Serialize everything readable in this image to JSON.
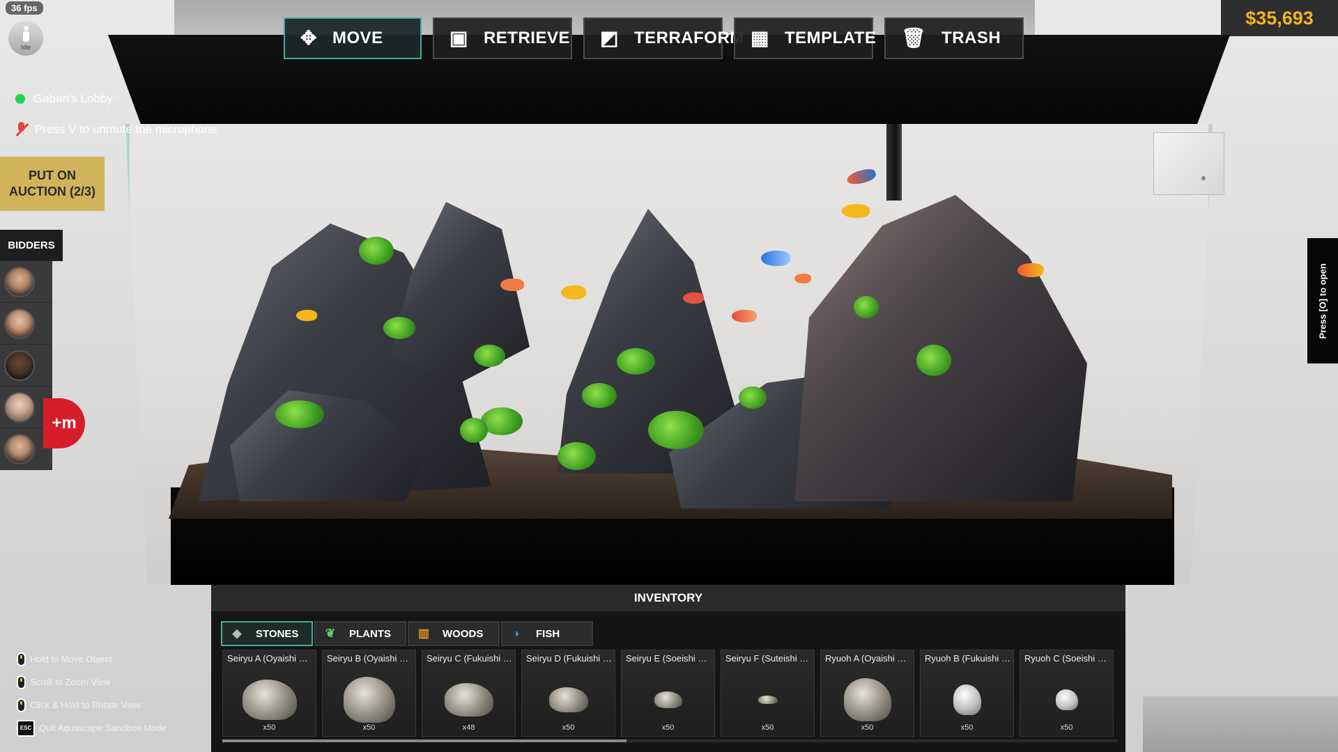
{
  "hud": {
    "fps": "36 fps",
    "status": "Idle",
    "lobby": "Gaban's Lobby",
    "mic_hint": "Press V to unmute the microphone",
    "money": "$35,693",
    "press_open": "Press [O] to open"
  },
  "auction": {
    "label_line1": "PUT ON",
    "label_line2": "AUCTION (2/3)",
    "bidders_title": "BIDDERS",
    "record_label": "+m"
  },
  "toolbar": [
    {
      "label": "MOVE",
      "icon": "move-icon",
      "active": true
    },
    {
      "label": "RETRIEVE",
      "icon": "retrieve-icon",
      "active": false
    },
    {
      "label": "TERRAFORM",
      "icon": "terraform-icon",
      "active": false
    },
    {
      "label": "TEMPLATE",
      "icon": "template-icon",
      "active": false
    },
    {
      "label": "TRASH",
      "icon": "trash-icon",
      "active": false
    }
  ],
  "inventory": {
    "title": "INVENTORY",
    "tabs": [
      {
        "label": "STONES",
        "icon": "stone-icon",
        "active": true
      },
      {
        "label": "PLANTS",
        "icon": "plant-icon",
        "active": false
      },
      {
        "label": "WOODS",
        "icon": "wood-icon",
        "active": false
      },
      {
        "label": "FISH",
        "icon": "fish-icon",
        "active": false
      }
    ],
    "items": [
      {
        "name": "Seiryu A (Oyaishi Si...",
        "qty": "x50"
      },
      {
        "name": "Seiryu B (Oyaishi Si...",
        "qty": "x50"
      },
      {
        "name": "Seiryu C (Fukuishi S...",
        "qty": "x48"
      },
      {
        "name": "Seiryu D (Fukuishi S...",
        "qty": "x50"
      },
      {
        "name": "Seiryu E (Soeishi Si...",
        "qty": "x50"
      },
      {
        "name": "Seiryu F (Suteishi Si...",
        "qty": "x50"
      },
      {
        "name": "Ryuoh A (Oyaishi Siz...",
        "qty": "x50"
      },
      {
        "name": "Ryuoh B (Fukuishi S...",
        "qty": "x50"
      },
      {
        "name": "Ryuoh C (Soeishi Si...",
        "qty": "x50"
      }
    ]
  },
  "hints": [
    {
      "text": "Hold to Move Object",
      "icon": "mouse-icon"
    },
    {
      "text": "Scroll to Zoom View",
      "icon": "mouse-icon"
    },
    {
      "text": "Click & Hold to Rotate View",
      "icon": "mouse-icon"
    },
    {
      "text": "Quit Aquascape Sandbox Mode",
      "icon": "esc-key-icon",
      "key": "ESC"
    }
  ],
  "colors": {
    "accent": "#3fae9a",
    "money": "#f1b41d",
    "auction": "#d1b45a",
    "online": "#1ed74a",
    "record": "#d61e2a"
  }
}
